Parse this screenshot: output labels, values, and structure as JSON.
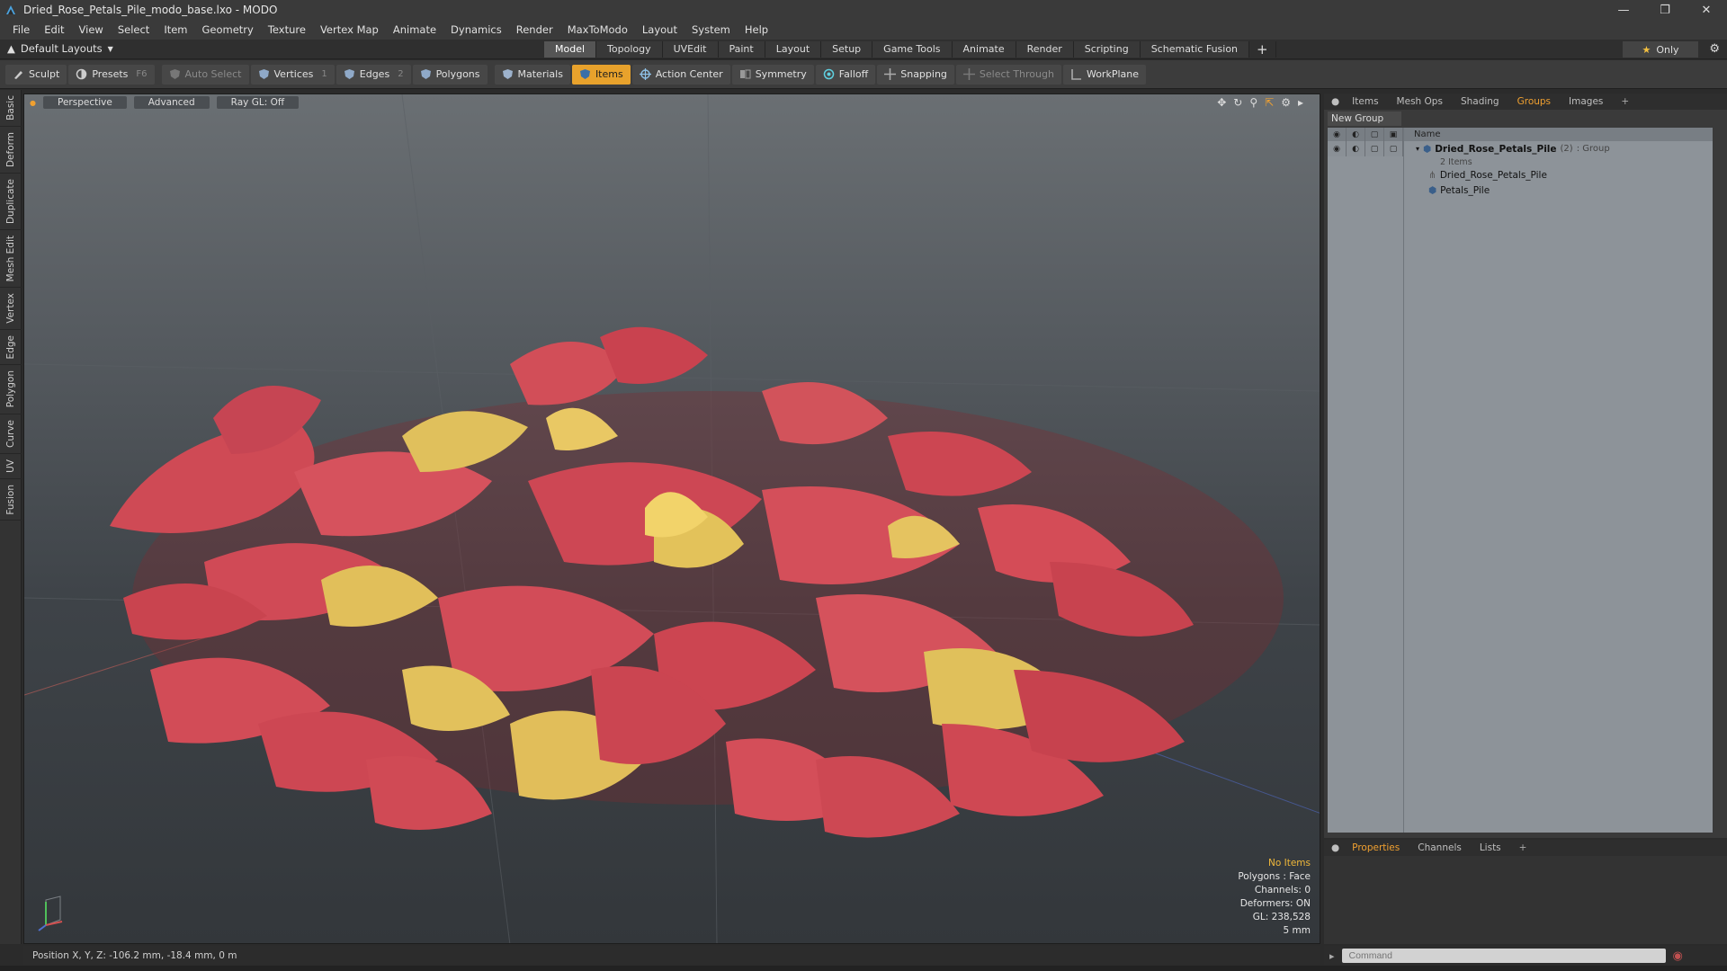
{
  "window": {
    "title": "Dried_Rose_Petals_Pile_modo_base.lxo - MODO",
    "controls": [
      "minimize",
      "restore",
      "close"
    ]
  },
  "menubar": [
    "File",
    "Edit",
    "View",
    "Select",
    "Item",
    "Geometry",
    "Texture",
    "Vertex Map",
    "Animate",
    "Dynamics",
    "Render",
    "MaxToModo",
    "Layout",
    "System",
    "Help"
  ],
  "layoutbar": {
    "layout_select": "Default Layouts",
    "tabs": [
      "Model",
      "Topology",
      "UVEdit",
      "Paint",
      "Layout",
      "Setup",
      "Game Tools",
      "Animate",
      "Render",
      "Scripting",
      "Schematic Fusion"
    ],
    "active_tab": "Model",
    "only_label": "Only"
  },
  "toolbar": {
    "sculpt": "Sculpt",
    "presets": "Presets",
    "presets_key": "F6",
    "auto_select": "Auto Select",
    "vertices": "Vertices",
    "vertices_key": "1",
    "edges": "Edges",
    "edges_key": "2",
    "polygons": "Polygons",
    "materials": "Materials",
    "items": "Items",
    "action_center": "Action Center",
    "symmetry": "Symmetry",
    "falloff": "Falloff",
    "snapping": "Snapping",
    "select_through": "Select Through",
    "workplane": "WorkPlane"
  },
  "lefttabs": [
    "Basic",
    "Deform",
    "Duplicate",
    "Mesh Edit",
    "Vertex",
    "Edge",
    "Polygon",
    "Curve",
    "UV",
    "Fusion"
  ],
  "viewport": {
    "view": "Perspective",
    "shading": "Advanced",
    "raygl": "Ray GL: Off",
    "info": {
      "selection": "No Items",
      "polygons": "Polygons : Face",
      "channels": "Channels: 0",
      "deformers": "Deformers: ON",
      "gl": "GL: 238,528",
      "grid": "5 mm"
    }
  },
  "statusbar": {
    "position": "Position X, Y, Z:   -106.2 mm, -18.4 mm, 0 m"
  },
  "right_panel": {
    "tabs": [
      "Items",
      "Mesh Ops",
      "Shading",
      "Groups",
      "Images"
    ],
    "active_tab": "Groups",
    "new_group": "New Group",
    "column_name": "Name",
    "group": {
      "name": "Dried_Rose_Petals_Pile",
      "count": "(2)",
      "type": ": Group",
      "items_label": "2 Items",
      "children": [
        "Dried_Rose_Petals_Pile",
        "Petals_Pile"
      ]
    }
  },
  "properties_panel": {
    "tabs": [
      "Properties",
      "Channels",
      "Lists"
    ],
    "active_tab": "Properties"
  },
  "command": {
    "placeholder": "Command"
  },
  "colors": {
    "accent": "#e8a22c",
    "petal_red": "#d2454f",
    "petal_yellow": "#e3c25a"
  }
}
